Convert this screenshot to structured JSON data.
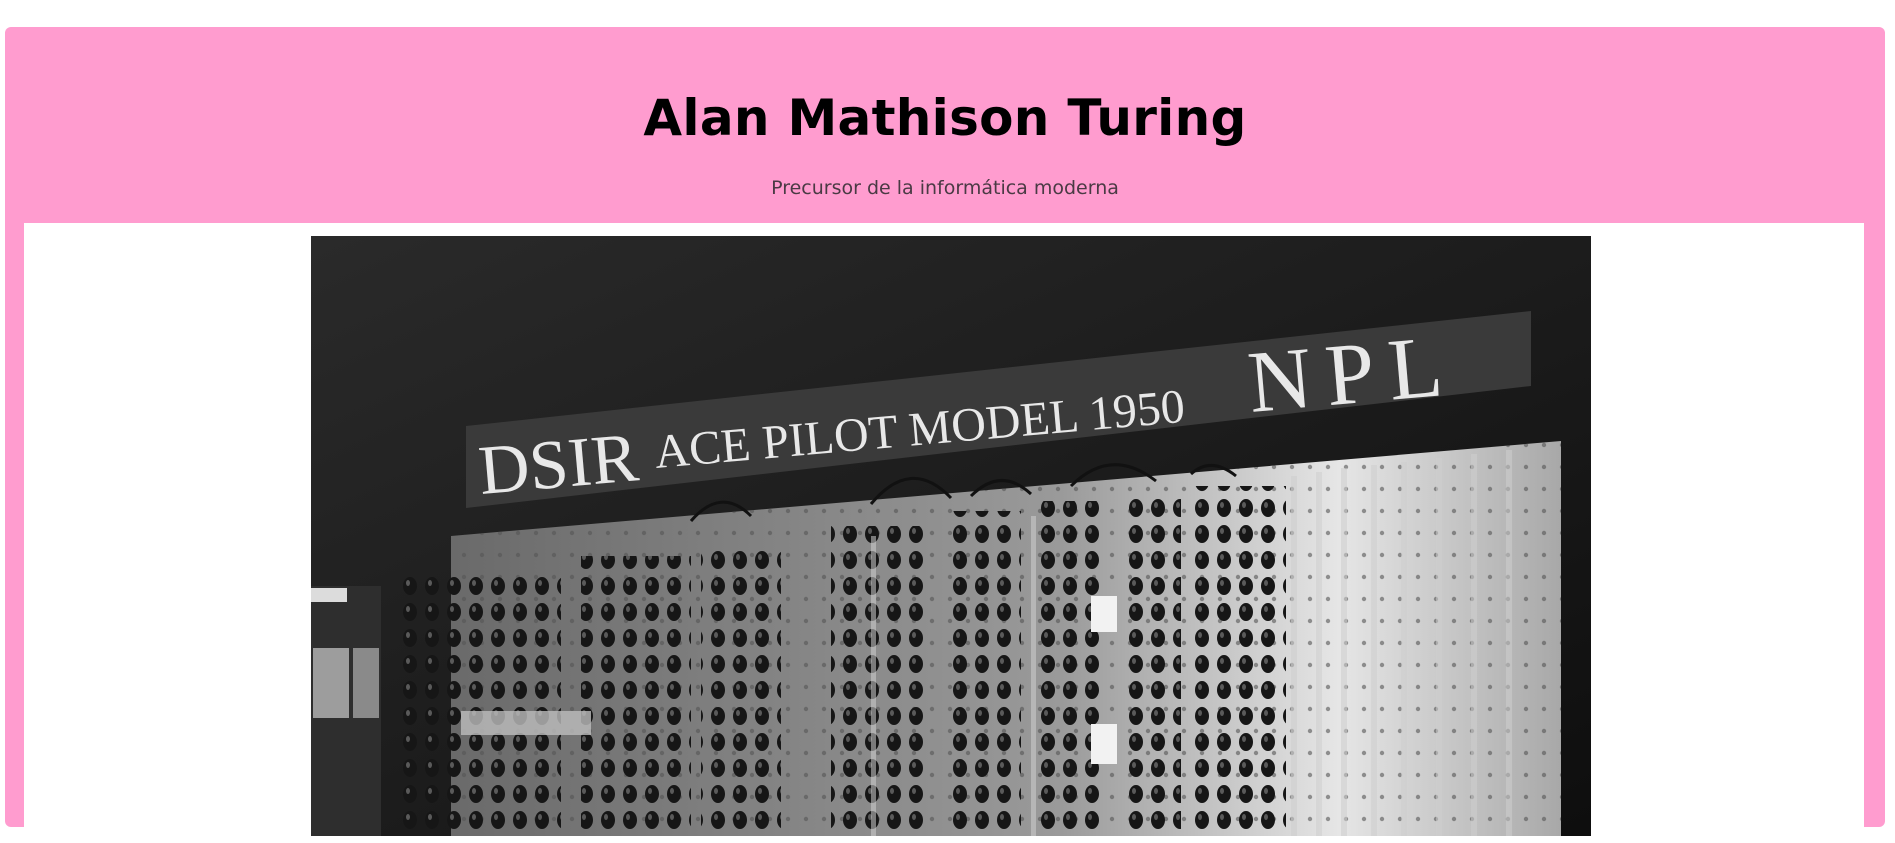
{
  "header": {
    "title": "Alan Mathison Turing",
    "subtitle": "Precursor de la informática moderna"
  },
  "photo": {
    "sign_dsir": "DSIR",
    "sign_model": "ACE PILOT MODEL 1950",
    "sign_npl": "NPL"
  },
  "colors": {
    "banner": "#ff9ccf",
    "content_bg": "#ffffff",
    "title": "#000000"
  }
}
